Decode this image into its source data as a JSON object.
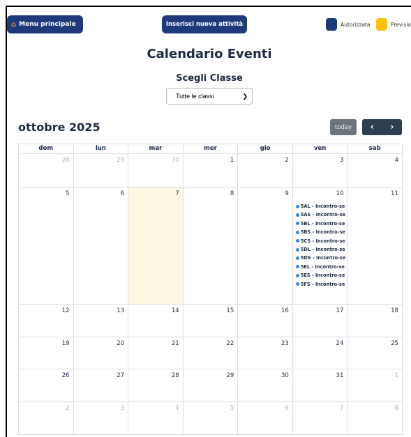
{
  "header": {
    "menu_label": "Menu principale",
    "insert_label": "Inserisci nuova attività",
    "legend": [
      {
        "label": "Autorizzata",
        "color": "#1f3a7a"
      },
      {
        "label": "Prevision",
        "color": "#ffc107"
      }
    ]
  },
  "page": {
    "title": "Calendario Eventi",
    "class_label": "Scegli Classe",
    "class_select_value": "Tutte le classi"
  },
  "calendar": {
    "month_title": "ottobre 2025",
    "today_label": "today",
    "prev_label": "‹",
    "next_label": "›",
    "weekdays": [
      "dom",
      "lun",
      "mar",
      "mer",
      "gio",
      "ven",
      "sab"
    ],
    "weeks": [
      [
        {
          "d": "28",
          "other": true
        },
        {
          "d": "29",
          "other": true
        },
        {
          "d": "30",
          "other": true
        },
        {
          "d": "1"
        },
        {
          "d": "2"
        },
        {
          "d": "3"
        },
        {
          "d": "4"
        }
      ],
      [
        {
          "d": "5"
        },
        {
          "d": "6"
        },
        {
          "d": "7",
          "today": true
        },
        {
          "d": "8"
        },
        {
          "d": "9"
        },
        {
          "d": "10",
          "events": [
            "5AL - Incontro-se",
            "5AS - Incontro-se",
            "5BL - Incontro-se",
            "5BS - Incontro-se",
            "5CS - Incontro-se",
            "5DL - Incontro-se",
            "5DS - Incontro-se",
            "5EL - Incontro-se",
            "5ES - Incontro-se",
            "5FS - Incontro-se"
          ]
        },
        {
          "d": "11"
        }
      ],
      [
        {
          "d": "12"
        },
        {
          "d": "13"
        },
        {
          "d": "14"
        },
        {
          "d": "15"
        },
        {
          "d": "16"
        },
        {
          "d": "17"
        },
        {
          "d": "18"
        }
      ],
      [
        {
          "d": "19"
        },
        {
          "d": "20"
        },
        {
          "d": "21"
        },
        {
          "d": "22"
        },
        {
          "d": "23"
        },
        {
          "d": "24"
        },
        {
          "d": "25"
        }
      ],
      [
        {
          "d": "26"
        },
        {
          "d": "27"
        },
        {
          "d": "28"
        },
        {
          "d": "29"
        },
        {
          "d": "30"
        },
        {
          "d": "31"
        },
        {
          "d": "1",
          "other": true
        }
      ],
      [
        {
          "d": "2",
          "other": true
        },
        {
          "d": "3",
          "other": true
        },
        {
          "d": "4",
          "other": true
        },
        {
          "d": "5",
          "other": true
        },
        {
          "d": "6",
          "other": true
        },
        {
          "d": "7",
          "other": true
        },
        {
          "d": "8",
          "other": true
        }
      ]
    ]
  }
}
